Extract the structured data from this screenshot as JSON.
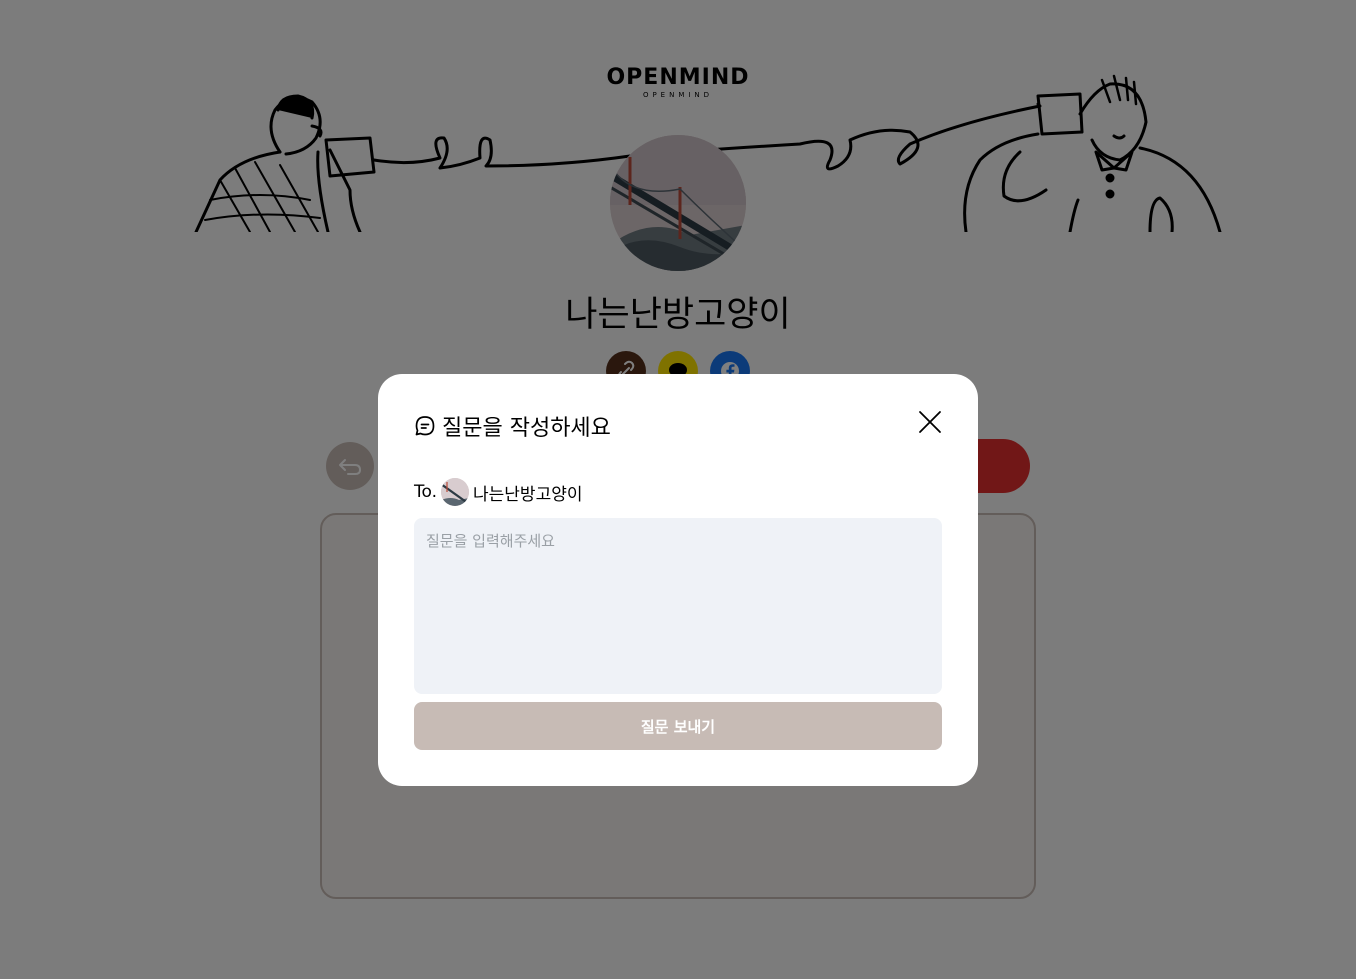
{
  "header": {
    "logo_main": "OPENMIND",
    "logo_sub": "OPENMIND"
  },
  "profile": {
    "name": "나는난방고양이"
  },
  "share_icons": [
    "link-icon",
    "kakaotalk-icon",
    "facebook-icon"
  ],
  "modal": {
    "title": "질문을 작성하세요",
    "to_label": "To.",
    "recipient_name": "나는난방고양이",
    "placeholder": "질문을 입력해주세요",
    "submit_label": "질문 보내기"
  },
  "colors": {
    "brown_dark": "#542f1a",
    "kakao_yellow": "#fee500",
    "facebook_blue": "#1877f2",
    "brown_light": "#c7bbb5",
    "accent_red": "#e22f2f",
    "input_bg": "#eff2f7"
  }
}
